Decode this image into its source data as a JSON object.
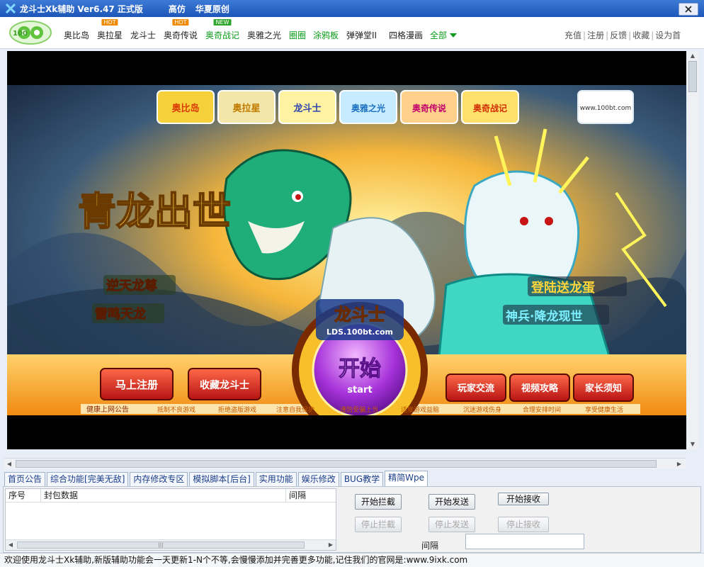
{
  "titlebar": {
    "title": "龙斗士Xk辅助 Ver6.47 正式版",
    "text2": "高仿",
    "text3": "华夏原创",
    "close_icon": "close-x-icon"
  },
  "nav": {
    "logo_text": "100",
    "items": [
      {
        "label": "奥比岛",
        "badge": ""
      },
      {
        "label": "奥拉星",
        "badge": "HOT"
      },
      {
        "label": "龙斗士",
        "badge": ""
      },
      {
        "label": "奥奇传说",
        "badge": "HOT"
      },
      {
        "label": "奥奇战记",
        "badge": "NEW"
      },
      {
        "label": "奥雅之光",
        "badge": ""
      },
      {
        "label": "圈圈",
        "badge": ""
      },
      {
        "label": "涂鸦板",
        "badge": ""
      },
      {
        "label": "弹弹堂II",
        "badge": ""
      },
      {
        "label": "四格漫画",
        "badge": ""
      },
      {
        "label": "全部",
        "badge": ""
      }
    ],
    "right_links": [
      "充值",
      "注册",
      "反馈",
      "收藏",
      "设为首"
    ]
  },
  "game": {
    "top_logos": [
      "奥比岛",
      "奥拉星",
      "龙斗士",
      "奥雅之光",
      "奥奇传说",
      "奥奇战记"
    ],
    "site_badge": "www.100bt.com",
    "headline": "青龙出世",
    "sub_left_1": "逆天龙尊",
    "sub_left_2": "雷鸣天龙",
    "promo_1": "登陆送龙蛋",
    "promo_2": "神兵·降龙现世",
    "logo_main": "龙斗士",
    "logo_url": "LDS.100bt.com",
    "start_cn": "开始",
    "start_en": "start",
    "btn_register": "马上注册",
    "btn_favorite": "收藏龙斗士",
    "btn_players": "玩家交流",
    "btn_video": "视频攻略",
    "btn_parents": "家长须知",
    "notice_title": "健康上网公告",
    "notices": [
      "抵制不良游戏",
      "拒绝盗版游戏",
      "注意自我保护",
      "谨防受骗上当",
      "适度游戏益脑",
      "沉迷游戏伤身",
      "合理安排时间",
      "享受健康生活"
    ]
  },
  "tabs": [
    "首页公告",
    "综合功能[完美无敌]",
    "内存修改专区",
    "模拟脚本[后台]",
    "实用功能",
    "娱乐修改",
    "BUG教学",
    "精简Wpe"
  ],
  "wpe": {
    "columns": [
      "序号",
      "封包数据",
      "间隔"
    ],
    "buttons": {
      "start_intercept": "开始拦截",
      "start_send": "开始发送",
      "start_receive": "开始接收",
      "stop_intercept": "停止拦截",
      "stop_send": "停止发送",
      "stop_receive": "停止接收"
    },
    "interval_label": "间隔",
    "interval_value": ""
  },
  "status": "欢迎使用龙斗士Xk辅助,新版辅助功能会一天更新1-N个不等,会慢慢添加并完善更多功能,记住我们的官网是:www.9ixk.com",
  "colors": {
    "title_blue": "#1d56b8",
    "nav_green": "#0a9b1a",
    "hot_orange": "#f08a00"
  }
}
